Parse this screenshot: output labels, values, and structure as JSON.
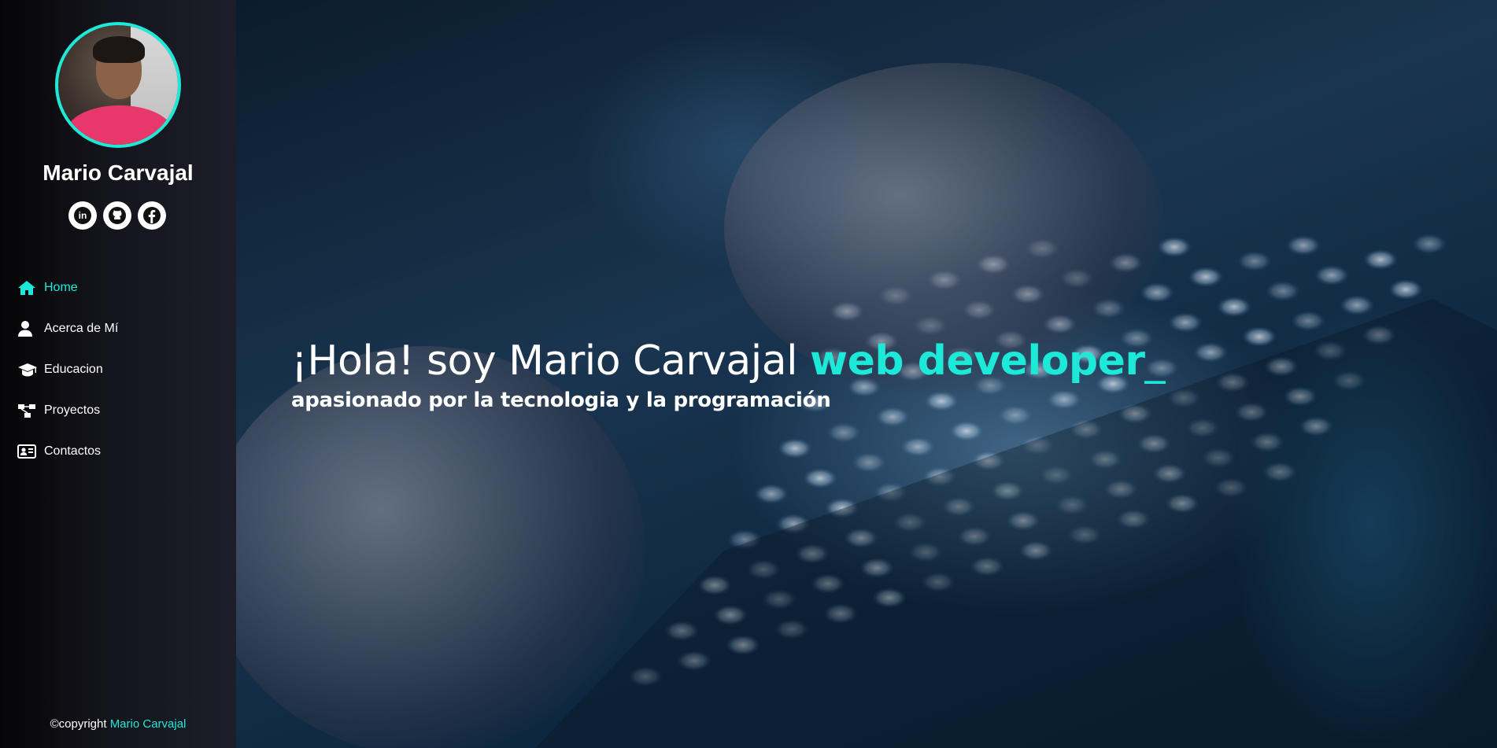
{
  "profile": {
    "name": "Mario Carvajal",
    "socials": [
      {
        "name": "linkedin-icon",
        "glyph": "in"
      },
      {
        "name": "github-icon",
        "glyph": "gh"
      },
      {
        "name": "facebook-icon",
        "glyph": "f"
      }
    ]
  },
  "nav": {
    "items": [
      {
        "label": "Home",
        "icon": "home-icon",
        "active": true
      },
      {
        "label": "Acerca de Mí",
        "icon": "user-icon",
        "active": false
      },
      {
        "label": "Educacion",
        "icon": "graduation-cap-icon",
        "active": false
      },
      {
        "label": "Proyectos",
        "icon": "sitemap-icon",
        "active": false
      },
      {
        "label": "Contactos",
        "icon": "id-card-icon",
        "active": false
      }
    ]
  },
  "footer": {
    "prefix": "©copyright ",
    "brand": "Mario Carvajal"
  },
  "hero": {
    "greeting": "¡Hola! soy Mario Carvajal ",
    "role": "web developer",
    "cursor": "_",
    "subtitle": "apasionado por la tecnologia y la programación"
  },
  "colors": {
    "accent": "#1de9d8",
    "sidebar": "#1e1e2a"
  }
}
